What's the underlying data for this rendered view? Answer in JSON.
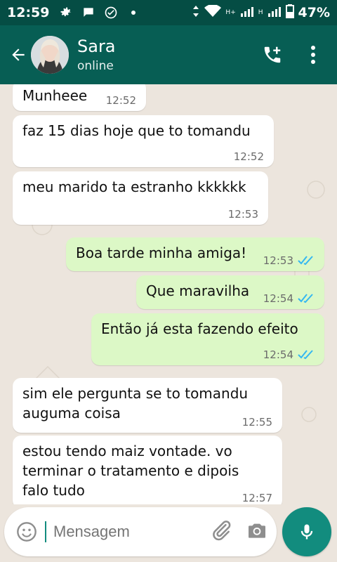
{
  "status_bar": {
    "time": "12:59",
    "network_h": "H+",
    "network_h2": "H",
    "battery": "47%"
  },
  "header": {
    "name": "Sara",
    "status": "online"
  },
  "messages": [
    {
      "dir": "in",
      "text": "Munheee",
      "time": "12:52"
    },
    {
      "dir": "in",
      "text": "faz 15 dias hoje que to tomandu",
      "time": "12:52"
    },
    {
      "dir": "in",
      "text": "meu marido ta estranho kkkkkk",
      "time": "12:53"
    },
    {
      "dir": "out",
      "text": "Boa tarde minha amiga!",
      "time": "12:53"
    },
    {
      "dir": "out",
      "text": "Que maravilha",
      "time": "12:54"
    },
    {
      "dir": "out",
      "text": "Então já esta fazendo efeito",
      "time": "12:54"
    },
    {
      "dir": "in",
      "text": "sim ele pergunta se to tomandu\nauguma coisa",
      "time": "12:55"
    },
    {
      "dir": "in",
      "text": "estou tendo maiz vontade. vo\nterminar o tratamento e dipois\nfalo tudo",
      "time": "12:57"
    }
  ],
  "composer": {
    "placeholder": "Mensagem"
  },
  "colors": {
    "header": "#075e54",
    "statusbar": "#054d44",
    "incoming": "#ffffff",
    "outgoing": "#dcf8c6",
    "accent": "#128c7e",
    "read_ticks": "#34b7f1"
  },
  "icons": {
    "back": "back-arrow-icon",
    "call": "add-call-icon",
    "menu": "more-vert-icon",
    "emoji": "emoji-icon",
    "attach": "paperclip-icon",
    "camera": "camera-icon",
    "mic": "mic-icon"
  }
}
